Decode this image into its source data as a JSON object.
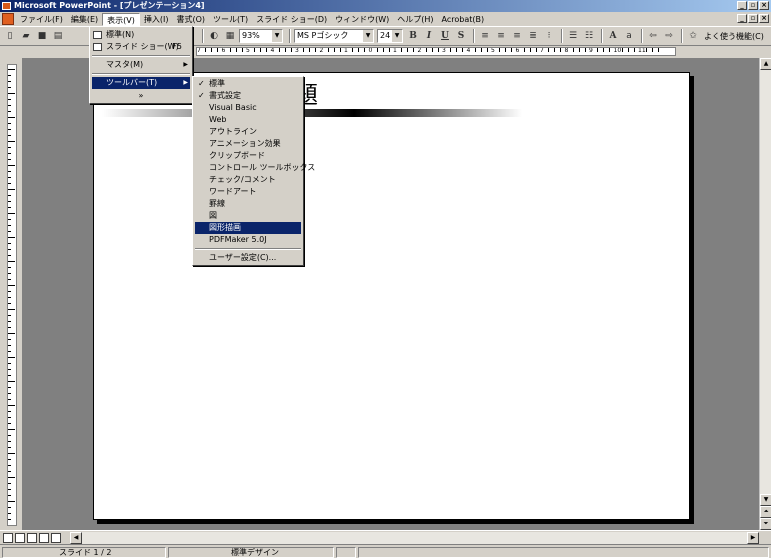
{
  "window": {
    "title": "Microsoft PowerPoint - [プレゼンテーション4]",
    "buttons": [
      "_",
      "▫",
      "×"
    ]
  },
  "menubar": {
    "items": [
      "ファイル(F)",
      "編集(E)",
      "表示(V)",
      "挿入(I)",
      "書式(O)",
      "ツール(T)",
      "スライド ショー(D)",
      "ウィンドウ(W)",
      "ヘルプ(H)",
      "Acrobat(B)"
    ]
  },
  "toolbar": {
    "zoom": "93%",
    "font": "MS Pゴシック",
    "size": "24",
    "frequent_label": "よく使う機能(C)"
  },
  "hruler": {
    "labels": [
      "7",
      "6",
      "5",
      "4",
      "3",
      "2",
      "1",
      "0",
      "1",
      "2",
      "3",
      "4",
      "5",
      "6",
      "7",
      "8",
      "9",
      "10",
      "11"
    ]
  },
  "slide": {
    "title_fragment": "題"
  },
  "view_menu": {
    "items": [
      {
        "label": "標準(N)",
        "shortcut": ""
      },
      {
        "label": "スライド ショー(W)",
        "shortcut": "F5"
      },
      {
        "label": "マスタ(M)",
        "shortcut": ""
      },
      {
        "label": "ツールバー(T)",
        "shortcut": ""
      }
    ],
    "expand": "»"
  },
  "toolbar_menu": {
    "items": [
      {
        "label": "標準",
        "checked": true
      },
      {
        "label": "書式設定",
        "checked": true
      },
      {
        "label": "Visual Basic",
        "checked": false
      },
      {
        "label": "Web",
        "checked": false
      },
      {
        "label": "アウトライン",
        "checked": false
      },
      {
        "label": "アニメーション効果",
        "checked": false
      },
      {
        "label": "クリップボード",
        "checked": false
      },
      {
        "label": "コントロール ツールボックス",
        "checked": false
      },
      {
        "label": "チェック/コメント",
        "checked": false
      },
      {
        "label": "ワードアート",
        "checked": false
      },
      {
        "label": "罫線",
        "checked": false
      },
      {
        "label": "図",
        "checked": false
      },
      {
        "label": "図形描画",
        "checked": false
      },
      {
        "label": "PDFMaker 5.0J",
        "checked": false
      }
    ],
    "customize": "ユーザー設定(C)..."
  },
  "statusbar": {
    "slide": "スライド 1 / 2",
    "design": "標準デザイン"
  },
  "colors": {
    "title_active": "#0a246a",
    "menu_bg": "#d4d0c8",
    "workspace": "#808080"
  }
}
